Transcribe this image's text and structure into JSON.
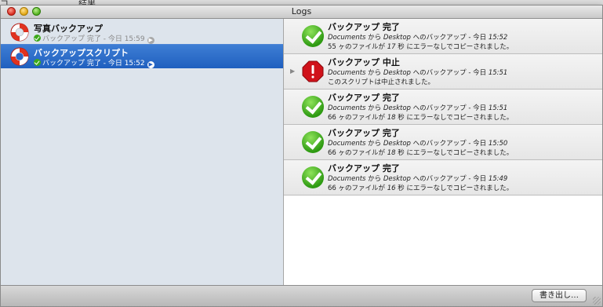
{
  "background": {
    "left_text": "コ",
    "word": "結果"
  },
  "window": {
    "title": "Logs"
  },
  "scripts": [
    {
      "name": "写真バックアップ",
      "status": "バックアップ 完了 - 今日 15:59",
      "selected": false
    },
    {
      "name": "バックアップスクリプト",
      "status": "バックアップ 完了 - 今日 15:52",
      "selected": true
    }
  ],
  "entries": [
    {
      "icon": "check-icon",
      "title": "バックアップ 完了",
      "source": "Documents",
      "from": " から ",
      "dest": "Desktop",
      "backup_word": " へのバックアップ - 今日 ",
      "time": "15:52",
      "detail_pre": "55 ヶのファイルが ",
      "seconds": "17",
      "detail_post": " 秒 にエラーなしでコピーされました。",
      "detail_full": ""
    },
    {
      "icon": "stop-icon",
      "title": "バックアップ 中止",
      "source": "Documents",
      "from": " から ",
      "dest": "Desktop",
      "backup_word": " へのバックアップ - 今日 ",
      "time": "15:51",
      "detail_pre": "",
      "seconds": "",
      "detail_post": "",
      "detail_full": "このスクリプトは中止されました。"
    },
    {
      "icon": "check-icon",
      "title": "バックアップ 完了",
      "source": "Documents",
      "from": " から ",
      "dest": "Desktop",
      "backup_word": " へのバックアップ - 今日 ",
      "time": "15:51",
      "detail_pre": "66 ヶのファイルが ",
      "seconds": "18",
      "detail_post": " 秒 にエラーなしでコピーされました。",
      "detail_full": ""
    },
    {
      "icon": "check-icon",
      "title": "バックアップ 完了",
      "source": "Documents",
      "from": " から ",
      "dest": "Desktop",
      "backup_word": " へのバックアップ - 今日 ",
      "time": "15:50",
      "detail_pre": "66 ヶのファイルが ",
      "seconds": "18",
      "detail_post": " 秒 にエラーなしでコピーされました。",
      "detail_full": ""
    },
    {
      "icon": "check-icon",
      "title": "バックアップ 完了",
      "source": "Documents",
      "from": " から ",
      "dest": "Desktop",
      "backup_word": " へのバックアップ - 今日 ",
      "time": "15:49",
      "detail_pre": "66 ヶのファイルが ",
      "seconds": "16",
      "detail_post": " 秒 にエラーなしでコピーされました。",
      "detail_full": ""
    }
  ],
  "footer": {
    "export_label": "書き出し…"
  },
  "colors": {
    "selection": "#2563c6",
    "success": "#3da91a",
    "stop": "#d0121a"
  }
}
